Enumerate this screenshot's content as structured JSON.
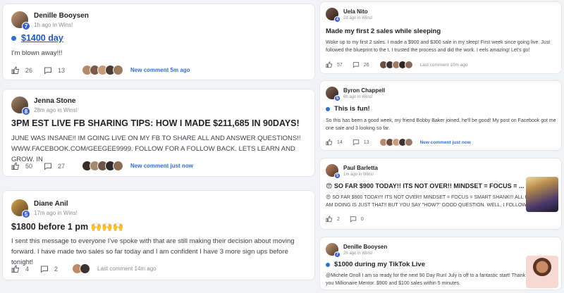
{
  "left_posts": [
    {
      "author": "Denille Booysen",
      "level": "7",
      "time": "1h ago",
      "in_label": "in",
      "category": "Wins!",
      "title": "$1400 day",
      "body": "I'm blown away!!!",
      "likes": "26",
      "comments": "13",
      "activity": "New comment 5m ago",
      "activity_style": "new"
    },
    {
      "author": "Jenna Stone",
      "level": "8",
      "time": "28m ago",
      "in_label": "in",
      "category": "Wins!",
      "title": "3PM EST LIVE FB SHARING TIPS: HOW I MADE $211,685 IN 90DAYS!",
      "body": "JUNE WAS INSANE!! IM GOING LIVE ON MY FB TO SHARE ALL AND ANSWER QUESTIONS!! WWW.FACEBOOK.COM/GEEGEE9999. FOLLOW FOR A FOLLOW BACK. LETS LEARN AND GROW. IN",
      "likes": "50",
      "comments": "27",
      "activity": "New comment just now",
      "activity_style": "new"
    },
    {
      "author": "Diane Anil",
      "level": "5",
      "time": "17m ago",
      "in_label": "in",
      "category": "Wins!",
      "title": "$1800 before 1 pm 🙌🙌🙌",
      "body": "I sent this message to everyone I've spoke with that are still making their decision about moving forward. I have made two sales so far today and I am confident I have 3 more sign ups before tonight!",
      "likes": "4",
      "comments": "2",
      "activity": "Last comment 14m ago",
      "activity_style": "last"
    }
  ],
  "right_posts": [
    {
      "author": "Uela Nito",
      "level": "4",
      "time": "2d ago",
      "in_label": "in",
      "category": "Wins!",
      "title": "Made my first 2 sales while sleeping",
      "body": "Woke up to my first 2 sales. I made a $900 and $300 sale in my sleep! First week since going live. Just followed the blueprint to the t. I trusted the process and did the work. I eels amazing! Let's go!",
      "likes": "57",
      "comments": "26",
      "activity": "Last comment 10m ago",
      "activity_style": "last"
    },
    {
      "author": "Byron Chappell",
      "level": "5",
      "time": "6h ago",
      "in_label": "in",
      "category": "Wins!",
      "title": "This is fun!",
      "body": "So this has been a good week, my friend Bobby Baker joined, he'll be good! My post on Facebook got me one sale and 3 looking so far.",
      "likes": "14",
      "comments": "13",
      "activity": "New comment just now",
      "activity_style": "new"
    },
    {
      "author": "Paul Barletta",
      "level": "5",
      "time": "1m ago",
      "in_label": "in",
      "category": "Wins!",
      "title": "😍 SO FAR $900 TODAY!! ITS NOT OVER!! MINDSET = FOCUS = ...",
      "body": "😍 SO FAR $900 TODAY!! ITS NOT OVER!! MINDSET = FOCUS = SMART SHANK!!! ALL I AM DOING IS JUST THAT!! BUT YOU SAY \"HOW?\" GOOD QUESTION. WELL, I FOLLOW",
      "likes": "2",
      "comments": "0",
      "activity": "",
      "activity_style": "none",
      "thumb": "mindset-poster"
    },
    {
      "author": "Denille Booysen",
      "level": "7",
      "time": "2h ago",
      "in_label": "in",
      "category": "Wins!",
      "title": "$1000 during my TikTok Live",
      "body": "@Michele Onoll I am so ready for the next 90 Day Run! July is off to a fantastic start! Thank you Millionaire Mentor. $900 and $100 sales within 5 minutes.",
      "likes": "",
      "comments": "",
      "activity": "",
      "activity_style": "none",
      "thumb": "woman-photo"
    }
  ],
  "icons": {
    "like": "thumbs-up-icon",
    "comment": "comment-icon",
    "pin": "blue-dot"
  },
  "colors": {
    "accent": "#2f6fd6",
    "link": "#2457c5",
    "level_badge": "#3b5bdb"
  }
}
